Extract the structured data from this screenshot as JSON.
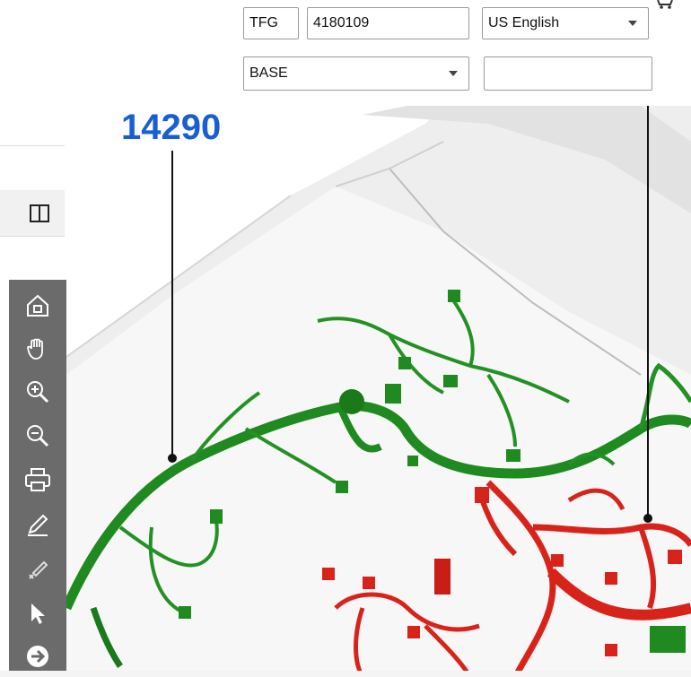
{
  "filters": {
    "code": "TFG",
    "number": "4180109",
    "language": "US English",
    "option": "BASE",
    "extra_value": ""
  },
  "viewer": {
    "callout_label": "14290"
  },
  "toolbar": {
    "tools": [
      "home-icon",
      "pan-hand-icon",
      "zoom-in-icon",
      "zoom-out-icon",
      "print-icon",
      "pen-icon",
      "eraser-icon",
      "pointer-icon",
      "next-arrow-icon"
    ]
  },
  "colors": {
    "harness_green": "#1f8a1f",
    "harness_red": "#d8231a",
    "callout_blue": "#1a5fd0",
    "toolbar_grey": "#6b6b6b"
  }
}
